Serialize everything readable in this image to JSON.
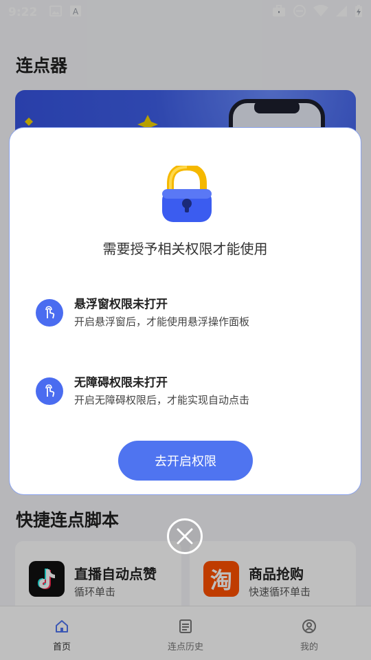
{
  "status_bar": {
    "time": "9:22",
    "left_icons": [
      "image-icon",
      "a-icon"
    ],
    "right_icons": [
      "briefcase-icon",
      "dnd-icon",
      "wifi-icon",
      "signal-icon",
      "battery-charging-icon"
    ]
  },
  "page": {
    "title": "连点器",
    "section_title": "快捷连点脚本",
    "cards": [
      {
        "title": "直播自动点赞",
        "subtitle": "循环单击",
        "logo": "tiktok-logo"
      },
      {
        "title": "商品抢购",
        "subtitle": "快速循环单击",
        "logo": "taobao-logo",
        "logo_text": "淘"
      }
    ]
  },
  "tabbar": {
    "items": [
      {
        "label": "首页",
        "icon": "home-icon",
        "active": true
      },
      {
        "label": "连点历史",
        "icon": "list-icon",
        "active": false
      },
      {
        "label": "我的",
        "icon": "profile-icon",
        "active": false
      }
    ]
  },
  "dialog": {
    "title": "需要授予相关权限才能使用",
    "permissions": [
      {
        "title": "悬浮窗权限未打开",
        "desc": "开启悬浮窗后，才能使用悬浮操作面板",
        "icon": "tap-hand-icon"
      },
      {
        "title": "无障碍权限未打开",
        "desc": "开启无障碍权限后，才能实现自动点击",
        "icon": "tap-hand-icon"
      }
    ],
    "button_label": "去开启权限"
  },
  "colors": {
    "accent": "#4f74f0",
    "banner": "#3f5fe8",
    "lock_shackle": "#f5b800",
    "lock_body": "#3b5cf0"
  }
}
